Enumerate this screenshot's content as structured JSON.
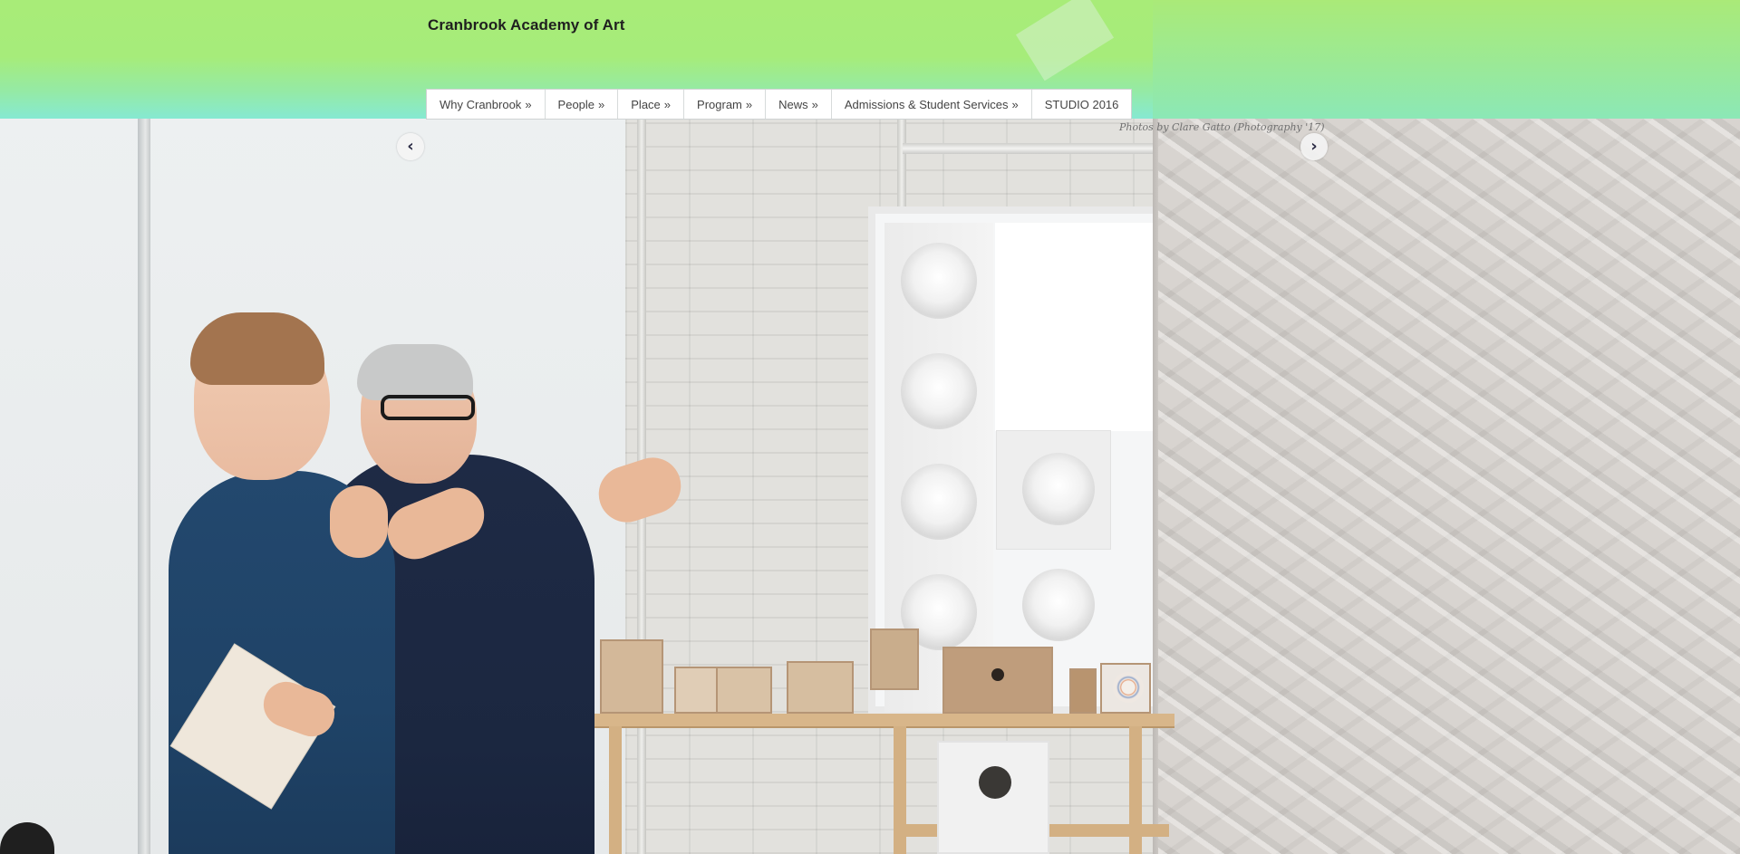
{
  "site": {
    "title": "Cranbrook Academy of Art"
  },
  "nav": {
    "items": [
      {
        "label": "Why Cranbrook",
        "suffix": "»"
      },
      {
        "label": "People",
        "suffix": "»"
      },
      {
        "label": "Place",
        "suffix": "»"
      },
      {
        "label": "Program",
        "suffix": "»"
      },
      {
        "label": "News",
        "suffix": "»"
      },
      {
        "label": "Admissions & Student Services",
        "suffix": "»"
      },
      {
        "label": "STUDIO 2016",
        "suffix": ""
      }
    ]
  },
  "slider": {
    "caption": "Photos by Clare Gatto (Photography '17)",
    "prev_glyph": "‹",
    "next_glyph": "›"
  },
  "colors": {
    "header_top": "#a8ec78",
    "header_bottom": "#86e9d2",
    "nav_text": "#444444"
  },
  "icons": {
    "prev": "chevron-left-icon",
    "next": "chevron-right-icon"
  }
}
